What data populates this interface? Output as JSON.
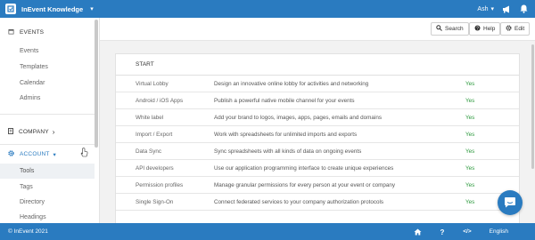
{
  "header": {
    "org_name": "InEvent Knowledge",
    "org_caret": "▾",
    "user_name": "Ash",
    "user_caret": "▾",
    "accent_color": "#2a7bc0"
  },
  "sidebar": {
    "events_section": "EVENTS",
    "events_items": [
      "Events",
      "Templates",
      "Calendar",
      "Admins"
    ],
    "company_section": "COMPANY",
    "company_caret": "›",
    "account_section": "ACCOUNT",
    "account_caret": "▾",
    "account_items": [
      "Tools",
      "Tags",
      "Directory",
      "Headings"
    ],
    "active_item": "Tools"
  },
  "toolbar": {
    "search_label": "Search",
    "help_label": "Help",
    "edit_label": "Edit"
  },
  "main": {
    "section_title": "START",
    "rows": [
      {
        "name": "Virtual Lobby",
        "description": "Design an innovative online lobby for activities and networking",
        "status": "Yes"
      },
      {
        "name": "Android / iOS Apps",
        "description": "Publish a powerful native mobile channel for your events",
        "status": "Yes"
      },
      {
        "name": "White label",
        "description": "Add your brand to logos, images, apps, pages, emails and domains",
        "status": "Yes"
      },
      {
        "name": "Import / Export",
        "description": "Work with spreadsheets for unlimited imports and exports",
        "status": "Yes"
      },
      {
        "name": "Data Sync",
        "description": "Sync spreadsheets with all kinds of data on ongoing events",
        "status": "Yes"
      },
      {
        "name": "API developers",
        "description": "Use our application programming interface to create unique experiences",
        "status": "Yes"
      },
      {
        "name": "Permission profiles",
        "description": "Manage granular permissions for every person at your event or company",
        "status": "Yes"
      },
      {
        "name": "Single Sign-On",
        "description": "Connect federated services to your company authorization protocols",
        "status": "Yes"
      }
    ],
    "status_color": "#2e9a3f"
  },
  "footer": {
    "copyright": "© InEvent 2021",
    "code_label": "</>",
    "language": "English"
  },
  "icons": [
    "org-logo-icon",
    "chevron-down-icon",
    "megaphone-icon",
    "bell-icon",
    "calendar-icon",
    "building-icon",
    "gear-icon",
    "mouse-cursor-icon",
    "search-icon",
    "help-icon",
    "edit-gear-icon",
    "chat-icon",
    "home-icon",
    "question-icon",
    "code-icon"
  ]
}
